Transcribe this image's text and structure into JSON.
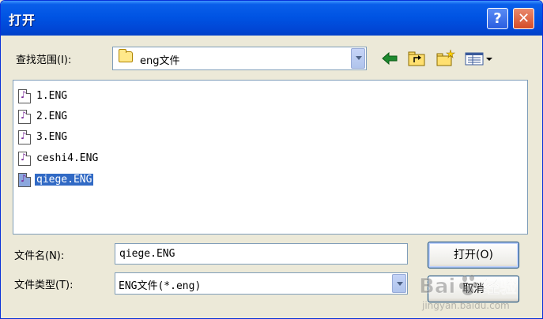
{
  "window": {
    "title": "打开",
    "help_glyph": "?",
    "close_glyph": "✕"
  },
  "lookin": {
    "label": "查找范围(I):",
    "value": "eng文件"
  },
  "files": [
    {
      "name": "1.ENG",
      "selected": false
    },
    {
      "name": "2.ENG",
      "selected": false
    },
    {
      "name": "3.ENG",
      "selected": false
    },
    {
      "name": "ceshi4.ENG",
      "selected": false
    },
    {
      "name": "qiege.ENG",
      "selected": true
    }
  ],
  "filename": {
    "label": "文件名(N):",
    "value": "qiege.ENG"
  },
  "filetype": {
    "label": "文件类型(T):",
    "value": "ENG文件(*.eng)"
  },
  "buttons": {
    "open": "打开(O)",
    "cancel": "取消"
  },
  "watermark": {
    "brand": "Bai",
    "brand2": "经验",
    "url": "jingyan.baidu.com"
  },
  "colors": {
    "titlebar": "#0054E3",
    "selection": "#316AC5",
    "dialog_bg": "#ECE9D8"
  }
}
